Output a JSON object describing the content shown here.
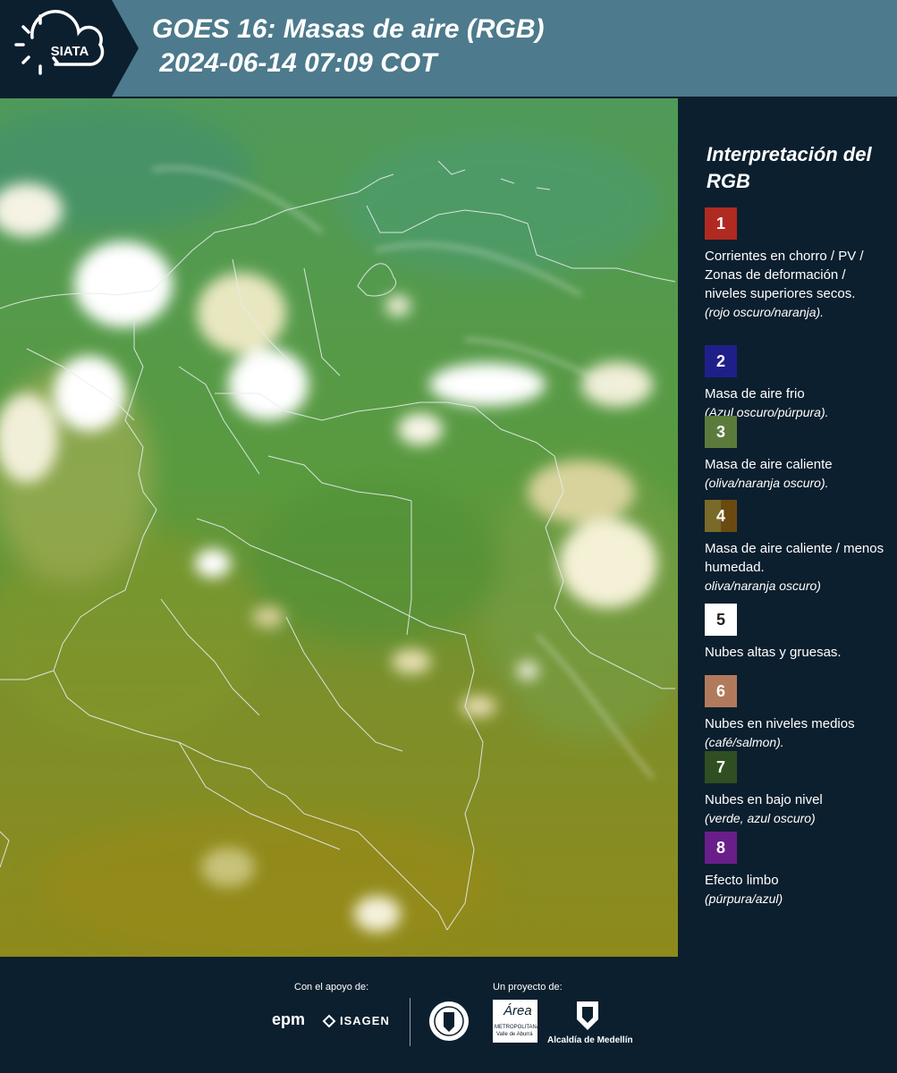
{
  "header": {
    "logo_text": "SIATA",
    "title_line1": "GOES 16: Masas de aire (RGB)",
    "title_line2": " 2024-06-14 07:09 COT"
  },
  "legend": {
    "title": "Interpretación del RGB",
    "items": [
      {
        "num": "1",
        "color": "#b02a22",
        "text": "Corrientes en chorro / PV / Zonas de deformación / niveles superiores secos.",
        "note": "(rojo oscuro/naranja)."
      },
      {
        "num": "2",
        "color": "#1f1f8a",
        "text": "Masa de aire frio",
        "note": "(Azul oscuro/púrpura)."
      },
      {
        "num": "3",
        "color": "#5b7b3c",
        "text": "Masa de aire caliente",
        "note": "(oliva/naranja oscuro)."
      },
      {
        "num": "4",
        "color": "#6b5a22",
        "text": "Masa de aire caliente / menos humedad.",
        "note": "oliva/naranja oscuro)"
      },
      {
        "num": "5",
        "color": "#ffffff",
        "text": "Nubes altas y gruesas.",
        "note": ""
      },
      {
        "num": "6",
        "color": "#b27a5c",
        "text": "Nubes en niveles medios",
        "note": "(café/salmon)."
      },
      {
        "num": "7",
        "color": "#2f4f22",
        "text": "Nubes en bajo nivel",
        "note": "(verde, azul oscuro)"
      },
      {
        "num": "8",
        "color": "#6a1e8a",
        "text": "Efecto limbo",
        "note": "(púrpura/azul)"
      }
    ]
  },
  "footer": {
    "support_label": "Con el apoyo de:",
    "project_label": "Un proyecto de:",
    "epm": "epm",
    "isagen": "ISAGEN",
    "area_name": "Área",
    "area_sub": "METROPOLITANA",
    "area_sub2": "Valle de Aburrá",
    "alcaldia": "Alcaldía de Medellín"
  }
}
